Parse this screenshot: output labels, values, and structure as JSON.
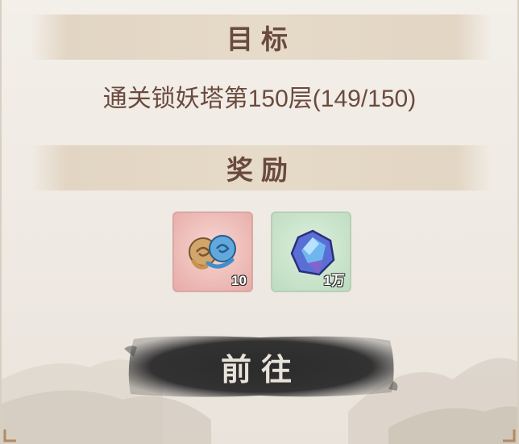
{
  "objective_section": {
    "title": "目标",
    "description": "通关锁妖塔第150层(149/150)"
  },
  "reward_section": {
    "title": "奖励",
    "items": [
      {
        "icon": "cloud-charm-icon",
        "count": "10",
        "bg_color": "#eab5b0"
      },
      {
        "icon": "blue-crystal-icon",
        "count": "1万",
        "bg_color": "#c6e2c7"
      }
    ]
  },
  "go_button": {
    "label": "前往"
  },
  "colors": {
    "title_text": "#6a4a3c",
    "body_text": "#6b4a3e",
    "button_bg": "#2b2b2b",
    "button_text": "#e7e2da"
  }
}
